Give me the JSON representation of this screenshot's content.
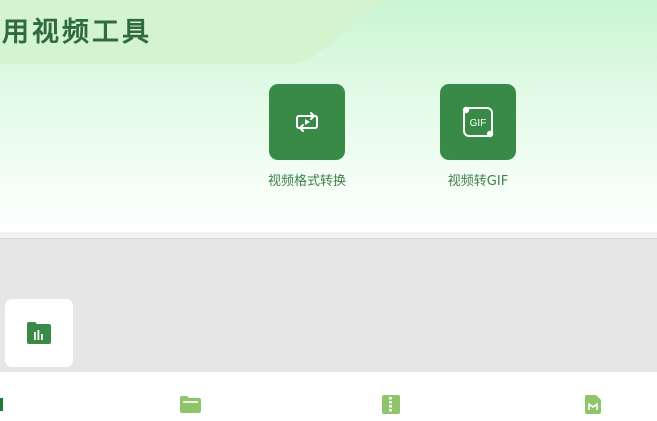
{
  "section": {
    "title": "常用视频工具"
  },
  "tools": [
    {
      "label": "视频格式转换",
      "icon": "video-convert-icon"
    },
    {
      "label": "视频转GIF",
      "icon": "gif-icon"
    }
  ],
  "gif_icon_text": "GIF",
  "theme": {
    "accent": "#3a8a47",
    "nav_icon": "#8fc46a",
    "label": "#3f7f4b"
  }
}
